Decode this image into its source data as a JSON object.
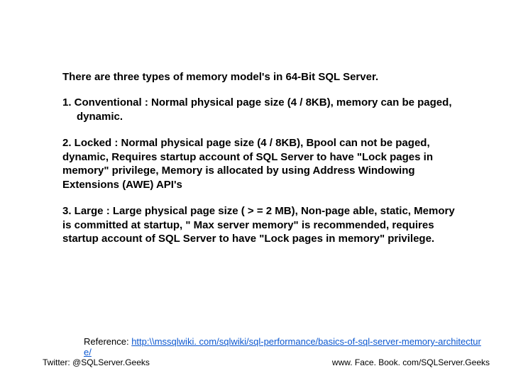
{
  "intro": "There are three types of memory model's in 64-Bit SQL Server.",
  "items": [
    "1.  Conventional : Normal physical page size (4 / 8KB), memory can be paged, dynamic.",
    "2.  Locked : Normal physical page size (4 / 8KB), Bpool can not be paged, dynamic, Requires startup account of SQL Server to have \"Lock pages in memory\" privilege, Memory is allocated by using Address Windowing Extensions (AWE) API's",
    "3.  Large : Large physical page size ( > = 2 MB), Non-page able, static, Memory is committed at startup, \" Max server memory\" is recommended, requires startup account of SQL Server to have \"Lock pages in memory\" privilege."
  ],
  "reference": {
    "label": "Reference: ",
    "url_text": "http:\\\\mssqlwiki. com/sqlwiki/sql-performance/basics-of-sql-server-memory-architecture/",
    "url_href": "http://mssqlwiki.com/sqlwiki/sql-performance/basics-of-sql-server-memory-architecture/"
  },
  "footer": {
    "twitter": "Twitter: @SQLServer.Geeks",
    "facebook": "www. Face. Book. com/SQLServer.Geeks"
  }
}
